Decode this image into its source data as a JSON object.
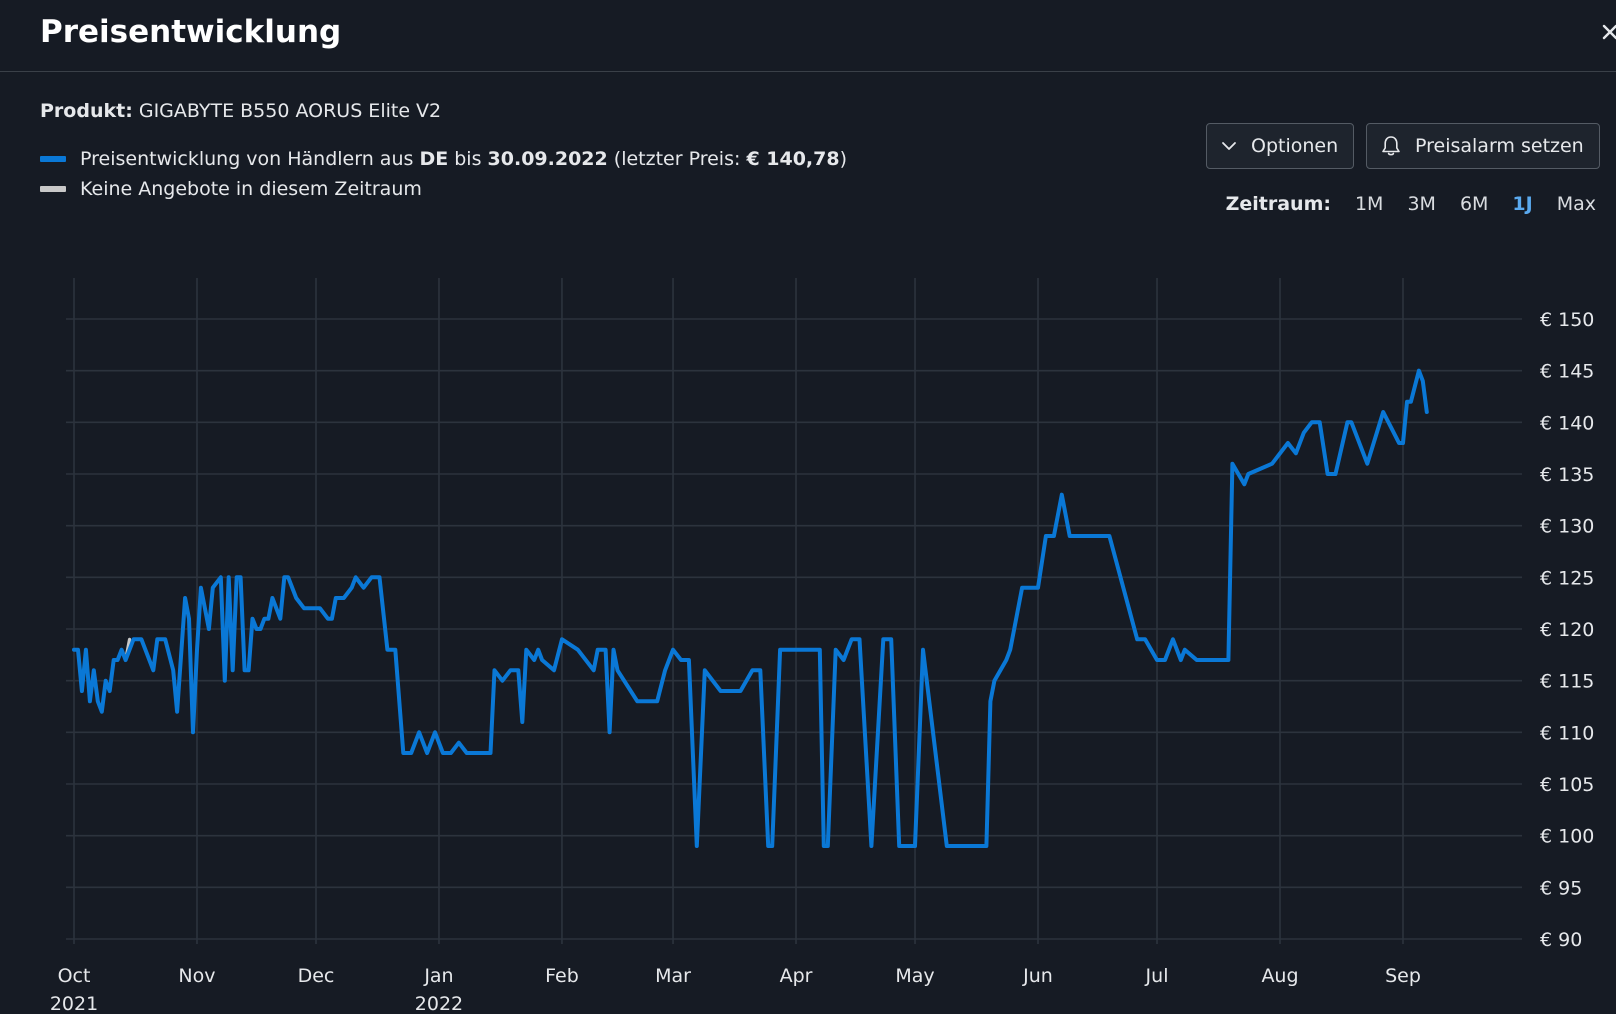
{
  "header": {
    "title": "Preisentwicklung"
  },
  "product": {
    "label": "Produkt:",
    "name": "GIGABYTE B550 AORUS Elite V2"
  },
  "legend": {
    "series_prefix": "Preisentwicklung von Händlern aus",
    "country": "DE",
    "until_word": "bis",
    "until_date": "30.09.2022",
    "last_price_prefix": "(letzter Preis:",
    "last_price": "€ 140,78",
    "last_price_suffix": ")",
    "no_offers": "Keine Angebote in diesem Zeitraum",
    "series_color": "#0a78d6",
    "no_offers_color": "#c8c8c8"
  },
  "toolbar": {
    "options_label": "Optionen",
    "alarm_label": "Preisalarm setzen"
  },
  "range": {
    "label": "Zeitraum:",
    "options": [
      "1M",
      "3M",
      "6M",
      "1J",
      "Max"
    ],
    "active": "1J"
  },
  "chart_data": {
    "type": "line",
    "x_type": "date",
    "xlim": [
      "2021-10-01",
      "2022-10-01"
    ],
    "ylim": [
      90,
      150
    ],
    "y_ticks": [
      90,
      95,
      100,
      105,
      110,
      115,
      120,
      125,
      130,
      135,
      140,
      145,
      150
    ],
    "y_tick_labels": [
      "€ 90",
      "€ 95",
      "€ 100",
      "€ 105",
      "€ 110",
      "€ 115",
      "€ 120",
      "€ 125",
      "€ 130",
      "€ 135",
      "€ 140",
      "€ 145",
      "€ 150"
    ],
    "x_ticks": [
      "2021-10-01",
      "2021-11-01",
      "2021-12-01",
      "2022-01-01",
      "2022-02-01",
      "2022-03-01",
      "2022-04-01",
      "2022-05-01",
      "2022-06-01",
      "2022-07-01",
      "2022-08-01",
      "2022-09-01"
    ],
    "x_tick_labels": [
      "Oct",
      "Nov",
      "Dec",
      "Jan",
      "Feb",
      "Mar",
      "Apr",
      "May",
      "Jun",
      "Jul",
      "Aug",
      "Sep"
    ],
    "x_tick_sublabels": [
      "2021",
      "",
      "",
      "2022",
      "",
      "",
      "",
      "",
      "",
      "",
      "",
      ""
    ],
    "grid": true,
    "series_color": "#0a78d6",
    "gap_color": "#c8c8c8",
    "gap_x": [
      "2021-10-14",
      "2021-10-15"
    ],
    "gap_y": [
      117,
      119
    ],
    "x": [
      "2021-10-01",
      "2021-10-02",
      "2021-10-03",
      "2021-10-04",
      "2021-10-05",
      "2021-10-06",
      "2021-10-07",
      "2021-10-08",
      "2021-10-09",
      "2021-10-10",
      "2021-10-11",
      "2021-10-12",
      "2021-10-13",
      "2021-10-14",
      "2021-10-16",
      "2021-10-18",
      "2021-10-21",
      "2021-10-22",
      "2021-10-24",
      "2021-10-26",
      "2021-10-27",
      "2021-10-29",
      "2021-10-30",
      "2021-10-31",
      "2021-11-01",
      "2021-11-02",
      "2021-11-03",
      "2021-11-04",
      "2021-11-05",
      "2021-11-07",
      "2021-11-08",
      "2021-11-09",
      "2021-11-10",
      "2021-11-11",
      "2021-11-12",
      "2021-11-13",
      "2021-11-14",
      "2021-11-15",
      "2021-11-16",
      "2021-11-17",
      "2021-11-18",
      "2021-11-19",
      "2021-11-20",
      "2021-11-22",
      "2021-11-23",
      "2021-11-24",
      "2021-11-26",
      "2021-11-28",
      "2021-12-01",
      "2021-12-02",
      "2021-12-04",
      "2021-12-05",
      "2021-12-06",
      "2021-12-08",
      "2021-12-10",
      "2021-12-11",
      "2021-12-13",
      "2021-12-15",
      "2021-12-17",
      "2021-12-19",
      "2021-12-21",
      "2021-12-23",
      "2021-12-25",
      "2021-12-27",
      "2021-12-29",
      "2021-12-31",
      "2022-01-02",
      "2022-01-04",
      "2022-01-06",
      "2022-01-08",
      "2022-01-10",
      "2022-01-11",
      "2022-01-12",
      "2022-01-13",
      "2022-01-14",
      "2022-01-15",
      "2022-01-17",
      "2022-01-19",
      "2022-01-21",
      "2022-01-22",
      "2022-01-23",
      "2022-01-25",
      "2022-01-26",
      "2022-01-27",
      "2022-01-30",
      "2022-02-01",
      "2022-02-05",
      "2022-02-09",
      "2022-02-10",
      "2022-02-12",
      "2022-02-13",
      "2022-02-14",
      "2022-02-15",
      "2022-02-20",
      "2022-02-22",
      "2022-02-24",
      "2022-02-25",
      "2022-02-27",
      "2022-03-01",
      "2022-03-03",
      "2022-03-05",
      "2022-03-07",
      "2022-03-09",
      "2022-03-11",
      "2022-03-13",
      "2022-03-15",
      "2022-03-18",
      "2022-03-21",
      "2022-03-23",
      "2022-03-25",
      "2022-03-26",
      "2022-03-28",
      "2022-04-01",
      "2022-04-02",
      "2022-04-04",
      "2022-04-05",
      "2022-04-07",
      "2022-04-08",
      "2022-04-09",
      "2022-04-11",
      "2022-04-13",
      "2022-04-15",
      "2022-04-17",
      "2022-04-20",
      "2022-04-23",
      "2022-04-25",
      "2022-04-27",
      "2022-04-29",
      "2022-05-01",
      "2022-05-03",
      "2022-05-09",
      "2022-05-15",
      "2022-05-19",
      "2022-05-20",
      "2022-05-21",
      "2022-05-24",
      "2022-05-25",
      "2022-05-26",
      "2022-05-28",
      "2022-05-30",
      "2022-06-01",
      "2022-06-03",
      "2022-06-05",
      "2022-06-07",
      "2022-06-09",
      "2022-06-11",
      "2022-06-16",
      "2022-06-18",
      "2022-06-19",
      "2022-06-26",
      "2022-06-28",
      "2022-07-01",
      "2022-07-03",
      "2022-07-05",
      "2022-07-07",
      "2022-07-08",
      "2022-07-11",
      "2022-07-14",
      "2022-07-15",
      "2022-07-19",
      "2022-07-20",
      "2022-07-23",
      "2022-07-24",
      "2022-07-30",
      "2022-08-03",
      "2022-08-05",
      "2022-08-07",
      "2022-08-09",
      "2022-08-11",
      "2022-08-13",
      "2022-08-15",
      "2022-08-18",
      "2022-08-19",
      "2022-08-23",
      "2022-08-27",
      "2022-08-31",
      "2022-09-01",
      "2022-09-02",
      "2022-09-03",
      "2022-09-05",
      "2022-09-06",
      "2022-09-07",
      "2022-09-09",
      "2022-09-10",
      "2022-09-11",
      "2022-09-12",
      "2022-09-13",
      "2022-09-15",
      "2022-09-17",
      "2022-09-18",
      "2022-09-19",
      "2022-09-20",
      "2022-09-21",
      "2022-09-22",
      "2022-09-23",
      "2022-09-24",
      "2022-09-25",
      "2022-09-26",
      "2022-09-27",
      "2022-09-28",
      "2022-09-29",
      "2022-09-30"
    ],
    "y": [
      118,
      118,
      114,
      118,
      113,
      116,
      113,
      112,
      115,
      114,
      117,
      117,
      118,
      117,
      119,
      119,
      116,
      119,
      119,
      116,
      112,
      123,
      121,
      110,
      118,
      124,
      122,
      120,
      124,
      125,
      115,
      125,
      116,
      125,
      125,
      116,
      116,
      121,
      120,
      120,
      121,
      121,
      123,
      121,
      125,
      125,
      123,
      122,
      122,
      122,
      121,
      121,
      123,
      123,
      124,
      125,
      124,
      125,
      125,
      118,
      118,
      108,
      108,
      110,
      108,
      110,
      108,
      108,
      109,
      108,
      108,
      108,
      108,
      108,
      108,
      116,
      115,
      116,
      116,
      111,
      118,
      117,
      118,
      117,
      116,
      119,
      118,
      116,
      118,
      118,
      110,
      118,
      116,
      113,
      113,
      113,
      113,
      116,
      118,
      117,
      117,
      99,
      116,
      115,
      114,
      114,
      114,
      116,
      116,
      99,
      99,
      118,
      118,
      118,
      118,
      118,
      118,
      99,
      99,
      118,
      117,
      119,
      119,
      99,
      119,
      119,
      99,
      99,
      99,
      118,
      99,
      99,
      99,
      113,
      115,
      117,
      118,
      120,
      124,
      124,
      124,
      129,
      129,
      133,
      129,
      129,
      129,
      129,
      129,
      119,
      119,
      117,
      117,
      119,
      117,
      118,
      117,
      117,
      117,
      117,
      136,
      134,
      135,
      136,
      138,
      137,
      139,
      140,
      140,
      135,
      135,
      140,
      140,
      136,
      141,
      138,
      138,
      142,
      142,
      145,
      144,
      141
    ]
  }
}
